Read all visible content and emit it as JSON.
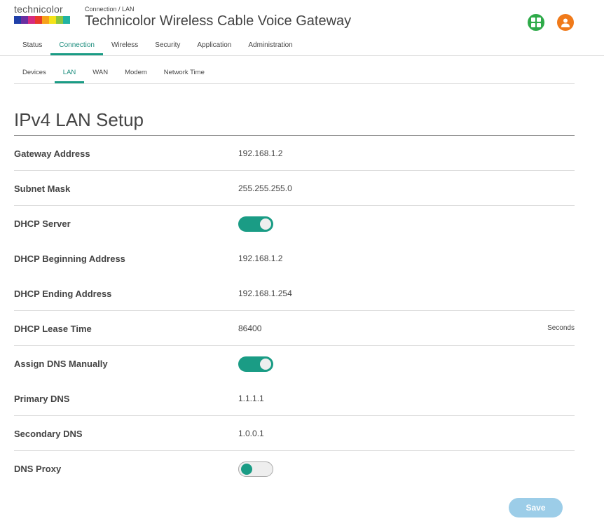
{
  "brand": {
    "logo_text": "technicolor",
    "logo_colors": [
      "#1f3fa8",
      "#6a2fa0",
      "#d62b80",
      "#e83a2a",
      "#f6a21c",
      "#f4e219",
      "#8cc63f",
      "#21b3a3"
    ]
  },
  "header": {
    "breadcrumb": "Connection / LAN",
    "title": "Technicolor Wireless Cable Voice Gateway",
    "icons": [
      "apps-grid-icon",
      "user-icon"
    ]
  },
  "main_tabs": [
    {
      "label": "Status",
      "active": false
    },
    {
      "label": "Connection",
      "active": true
    },
    {
      "label": "Wireless",
      "active": false
    },
    {
      "label": "Security",
      "active": false
    },
    {
      "label": "Application",
      "active": false
    },
    {
      "label": "Administration",
      "active": false
    }
  ],
  "sub_tabs": [
    {
      "label": "Devices",
      "active": false
    },
    {
      "label": "LAN",
      "active": true
    },
    {
      "label": "WAN",
      "active": false
    },
    {
      "label": "Modem",
      "active": false
    },
    {
      "label": "Network Time",
      "active": false
    }
  ],
  "section": {
    "title": "IPv4 LAN Setup"
  },
  "fields": {
    "gateway_address": {
      "label": "Gateway Address",
      "value": "192.168.1.2"
    },
    "subnet_mask": {
      "label": "Subnet Mask",
      "value": "255.255.255.0"
    },
    "dhcp_server": {
      "label": "DHCP Server",
      "enabled": true
    },
    "dhcp_begin": {
      "label": "DHCP Beginning Address",
      "value": "192.168.1.2"
    },
    "dhcp_end": {
      "label": "DHCP Ending Address",
      "value": "192.168.1.254"
    },
    "lease_time": {
      "label": "DHCP Lease Time",
      "value": "86400",
      "unit": "Seconds"
    },
    "assign_dns": {
      "label": "Assign DNS Manually",
      "enabled": true
    },
    "primary_dns": {
      "label": "Primary DNS",
      "value": "1.1.1.1"
    },
    "secondary_dns": {
      "label": "Secondary DNS",
      "value": "1.0.0.1"
    },
    "dns_proxy": {
      "label": "DNS Proxy",
      "enabled": false
    }
  },
  "actions": {
    "save_label": "Save"
  },
  "colors": {
    "accent": "#1a9c85",
    "save_button": "#9ccde8",
    "apps_icon": "#2eaa49",
    "user_icon": "#f07a1a"
  }
}
